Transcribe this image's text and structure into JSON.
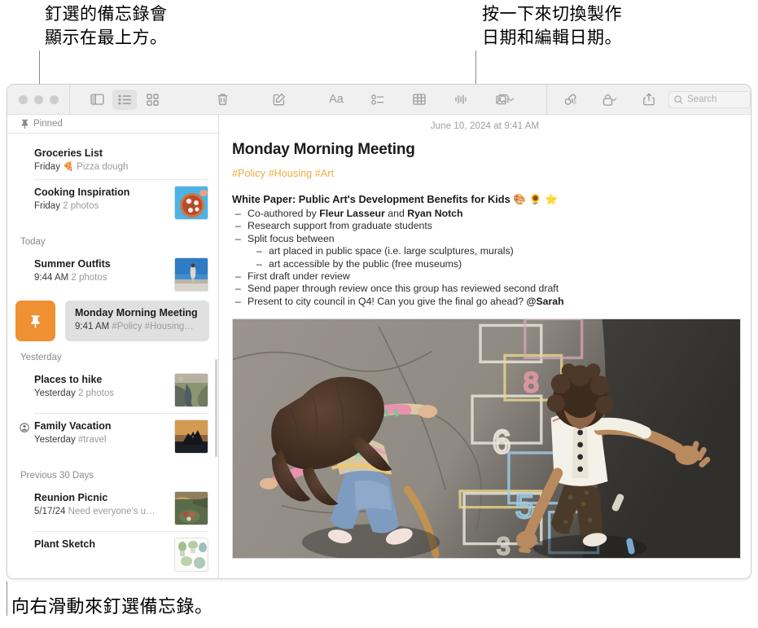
{
  "annotations": {
    "pinned_top": "釘選的備忘錄會\n顯示在最上方。",
    "date_toggle": "按一下來切換製作\n日期和編輯日期。",
    "swipe_pin": "向右滑動來釘選備忘錄。"
  },
  "toolbar": {
    "sidebar_toggle": "sidebar-toggle-icon",
    "list_view": "list-view-icon",
    "gallery_view": "gallery-view-icon",
    "delete": "trash-icon",
    "compose": "compose-icon",
    "format": "Aa",
    "checklist": "checklist-icon",
    "table": "table-icon",
    "audio": "audio-waveform-icon",
    "media": "media-icon",
    "collaborate": "collaborate-icon",
    "lock": "lock-icon",
    "share": "share-icon",
    "search_placeholder": "Search"
  },
  "sidebar": {
    "pinned_label": "Pinned",
    "groups": [
      {
        "title": "",
        "notes": [
          {
            "title": "Groceries List",
            "date": "Friday",
            "preview": "Pizza dough",
            "emoji": "🍕",
            "thumb": false
          },
          {
            "title": "Cooking Inspiration",
            "date": "Friday",
            "preview": "2 photos",
            "thumb": true,
            "thumb_kind": "pizza"
          }
        ]
      },
      {
        "title": "Today",
        "notes": [
          {
            "title": "Summer Outfits",
            "date": "9:44 AM",
            "preview": "2 photos",
            "thumb": true,
            "thumb_kind": "person-sky"
          }
        ]
      },
      {
        "title": "Yesterday",
        "notes": [
          {
            "title": "Places to hike",
            "date": "Yesterday",
            "preview": "2 photos",
            "thumb": true,
            "thumb_kind": "river"
          },
          {
            "title": "Family Vacation",
            "date": "Yesterday",
            "preview": "#travel",
            "thumb": true,
            "thumb_kind": "sunset-bike",
            "shared": true
          }
        ]
      },
      {
        "title": "Previous 30 Days",
        "notes": [
          {
            "title": "Reunion Picnic",
            "date": "5/17/24",
            "preview": "Need everyone's u…",
            "thumb": true,
            "thumb_kind": "picnic"
          },
          {
            "title": "Plant Sketch",
            "date": "",
            "preview": "",
            "thumb": true,
            "thumb_kind": "plants"
          }
        ]
      }
    ],
    "selected_note": {
      "title": "Monday Morning Meeting",
      "date": "9:41 AM",
      "preview": "#Policy #Housing…",
      "pin_action_icon": "pin-icon",
      "pin_action_color": "#ef9033"
    }
  },
  "note": {
    "date": "June 10, 2024 at 9:41 AM",
    "title": "Monday Morning Meeting",
    "tags": "#Policy #Housing #Art",
    "tags_color": "#f0ab3d",
    "heading": "White Paper: Public Art's Development Benefits for Kids 🎨 🌻 ⭐",
    "bullets": [
      {
        "text": "Co-authored by Fleur Lasseur and Ryan Notch",
        "indent": false,
        "bold_parts": [
          "Fleur Lasseur",
          "Ryan Notch"
        ]
      },
      {
        "text": "Research support from graduate students",
        "indent": false
      },
      {
        "text": "Split focus between",
        "indent": false
      },
      {
        "text": "art placed in public space (i.e. large sculptures, murals)",
        "indent": true
      },
      {
        "text": "art accessible by the public (free museums)",
        "indent": true
      },
      {
        "text": "First draft under review",
        "indent": false
      },
      {
        "text": "Send paper through review once this group has reviewed second draft",
        "indent": false
      },
      {
        "text": "Present to city council in Q4! Can you give the final go ahead? @Sarah",
        "indent": false,
        "bold_parts": [
          "@Sarah"
        ]
      }
    ],
    "photo_alt": "Two children playing hopscotch on asphalt with chalk numbers 8, 6, 5, 3"
  }
}
